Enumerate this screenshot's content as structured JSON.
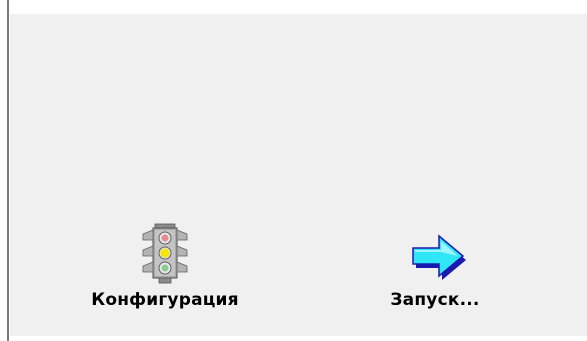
{
  "launchers": [
    {
      "label": "Конфигурация",
      "icon": "traffic-light-icon"
    },
    {
      "label": "Запуск...",
      "icon": "arrow-right-icon"
    }
  ],
  "colors": {
    "panel_background": "#f0f0f0",
    "border": "#7a7a7a",
    "arrow_cyan": "#2ee6f5",
    "arrow_blue": "#1a1ab0",
    "traffic_light_body": "#a8a8a8",
    "light_red": "#d84040",
    "light_yellow": "#f5e600",
    "light_green": "#3cb84a"
  }
}
